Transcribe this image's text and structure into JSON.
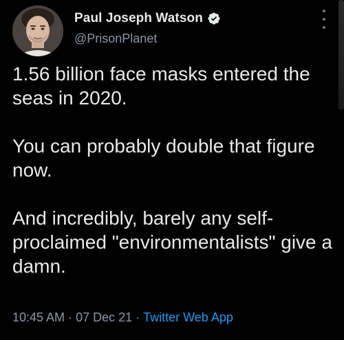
{
  "tweet": {
    "author": {
      "display_name": "Paul Joseph Watson",
      "handle": "@PrisonPlanet",
      "verified": true,
      "avatar_icon": "profile-photo"
    },
    "paragraphs": [
      "1.56 billion face masks entered the seas in 2020.",
      "You can probably double that figure now.",
      "And incredibly, barely any self-proclaimed \"environmentalists\" give a damn."
    ],
    "time": "10:45 AM",
    "date": "07 Dec 21",
    "separator": "·",
    "source_app": "Twitter Web App",
    "more_icon": "more-vertical-icon"
  },
  "colors": {
    "background": "#000000",
    "primary_text": "#e7e9ea",
    "secondary_text": "#8b98a5",
    "link": "#1d9bf0"
  }
}
